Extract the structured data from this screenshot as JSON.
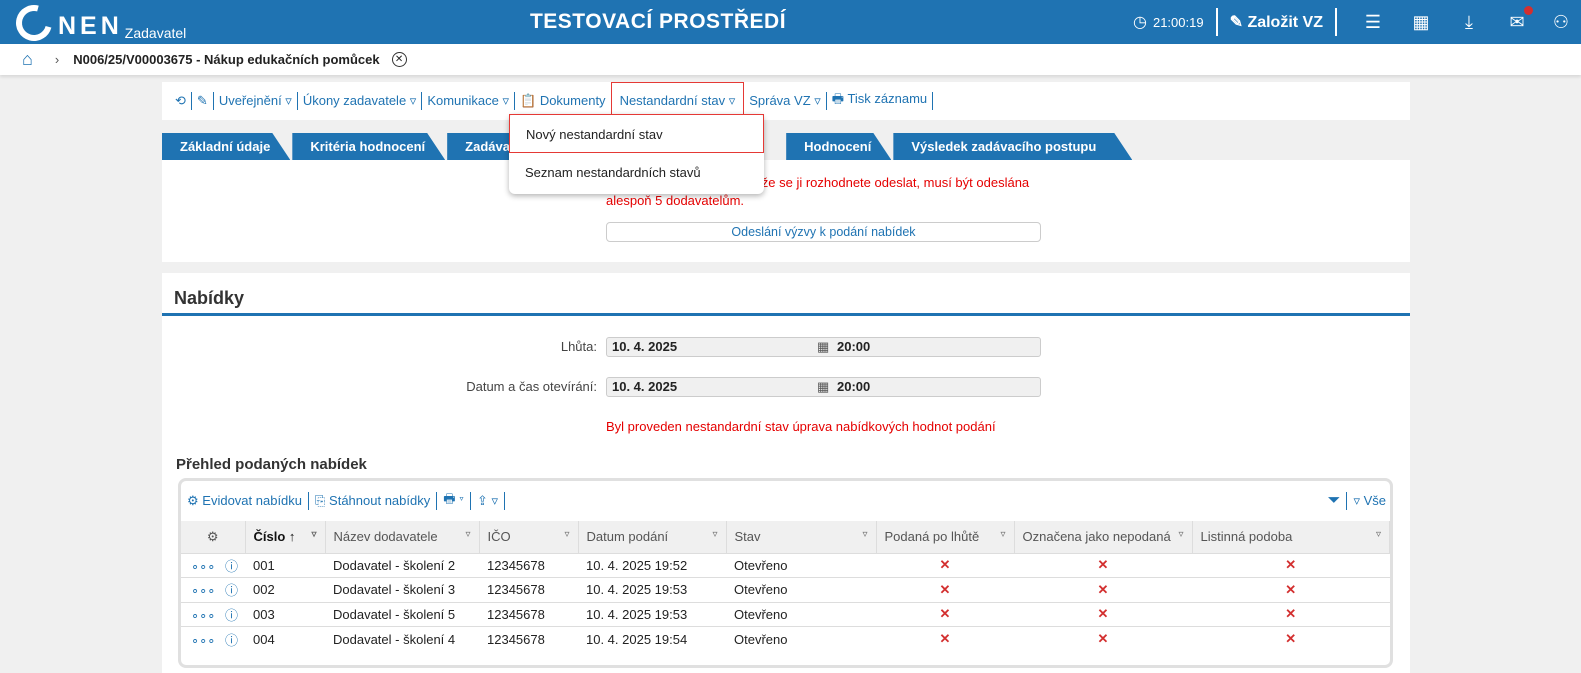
{
  "header": {
    "logo": "NEN",
    "logo_sub": "Zadavatel",
    "title": "TESTOVACÍ PROSTŘEDÍ",
    "time": "21:00:19",
    "create_label": "Založit VZ"
  },
  "breadcrumb": {
    "title": "N006/25/V00003675 - Nákup edukačních pomůcek"
  },
  "toolbar": {
    "items": [
      "Uveřejnění",
      "Úkony zadavatele",
      "Komunikace",
      "Dokumenty",
      "Nestandardní stav",
      "Správa VZ",
      "Tisk záznamu"
    ]
  },
  "dropdown": {
    "items": [
      "Nový nestandardní stav",
      "Seznam nestandardních stavů"
    ]
  },
  "tabs": [
    "Základní údaje",
    "Kritéria hodnocení",
    "Zadáva",
    "Hodnocení",
    "Výsledek zadávacího postupu"
  ],
  "notice": {
    "line1": "liže se ji rozhodnete odeslat, musí být odeslána",
    "line2": "alespoň 5 dodavatelům.",
    "button": "Odeslání výzvy k podání nabídek"
  },
  "offers": {
    "title": "Nabídky",
    "deadline_label": "Lhůta:",
    "deadline_date": "10. 4. 2025",
    "deadline_time": "20:00",
    "opening_label": "Datum a čas otevírání:",
    "opening_date": "10. 4. 2025",
    "opening_time": "20:00",
    "warning": "Byl proveden nestandardní stav úprava nabídkových hodnot podání",
    "subtitle": "Přehled podaných nabídek"
  },
  "grid": {
    "toolbar": {
      "register": "Evidovat nabídku",
      "download": "Stáhnout nabídky",
      "filter_all": "Vše"
    },
    "columns": [
      "Číslo",
      "Název dodavatele",
      "IČO",
      "Datum podání",
      "Stav",
      "Podaná po lhůtě",
      "Označena jako nepodaná",
      "Listinná podoba"
    ],
    "rows": [
      {
        "cislo": "001",
        "nazev": "Dodavatel - školení 2",
        "ico": "12345678",
        "datum": "10. 4. 2025 19:52",
        "stav": "Otevřeno",
        "po_lhute": false,
        "nepodana": false,
        "listinna": false
      },
      {
        "cislo": "002",
        "nazev": "Dodavatel - školení 3",
        "ico": "12345678",
        "datum": "10. 4. 2025 19:53",
        "stav": "Otevřeno",
        "po_lhute": false,
        "nepodana": false,
        "listinna": false
      },
      {
        "cislo": "003",
        "nazev": "Dodavatel - školení 5",
        "ico": "12345678",
        "datum": "10. 4. 2025 19:53",
        "stav": "Otevřeno",
        "po_lhute": false,
        "nepodana": false,
        "listinna": false
      },
      {
        "cislo": "004",
        "nazev": "Dodavatel - školení 4",
        "ico": "12345678",
        "datum": "10. 4. 2025 19:54",
        "stav": "Otevřeno",
        "po_lhute": false,
        "nepodana": false,
        "listinna": false
      }
    ]
  },
  "colors": {
    "brand": "#1f73b2",
    "error": "#e50000",
    "highlight": "#e53935"
  }
}
